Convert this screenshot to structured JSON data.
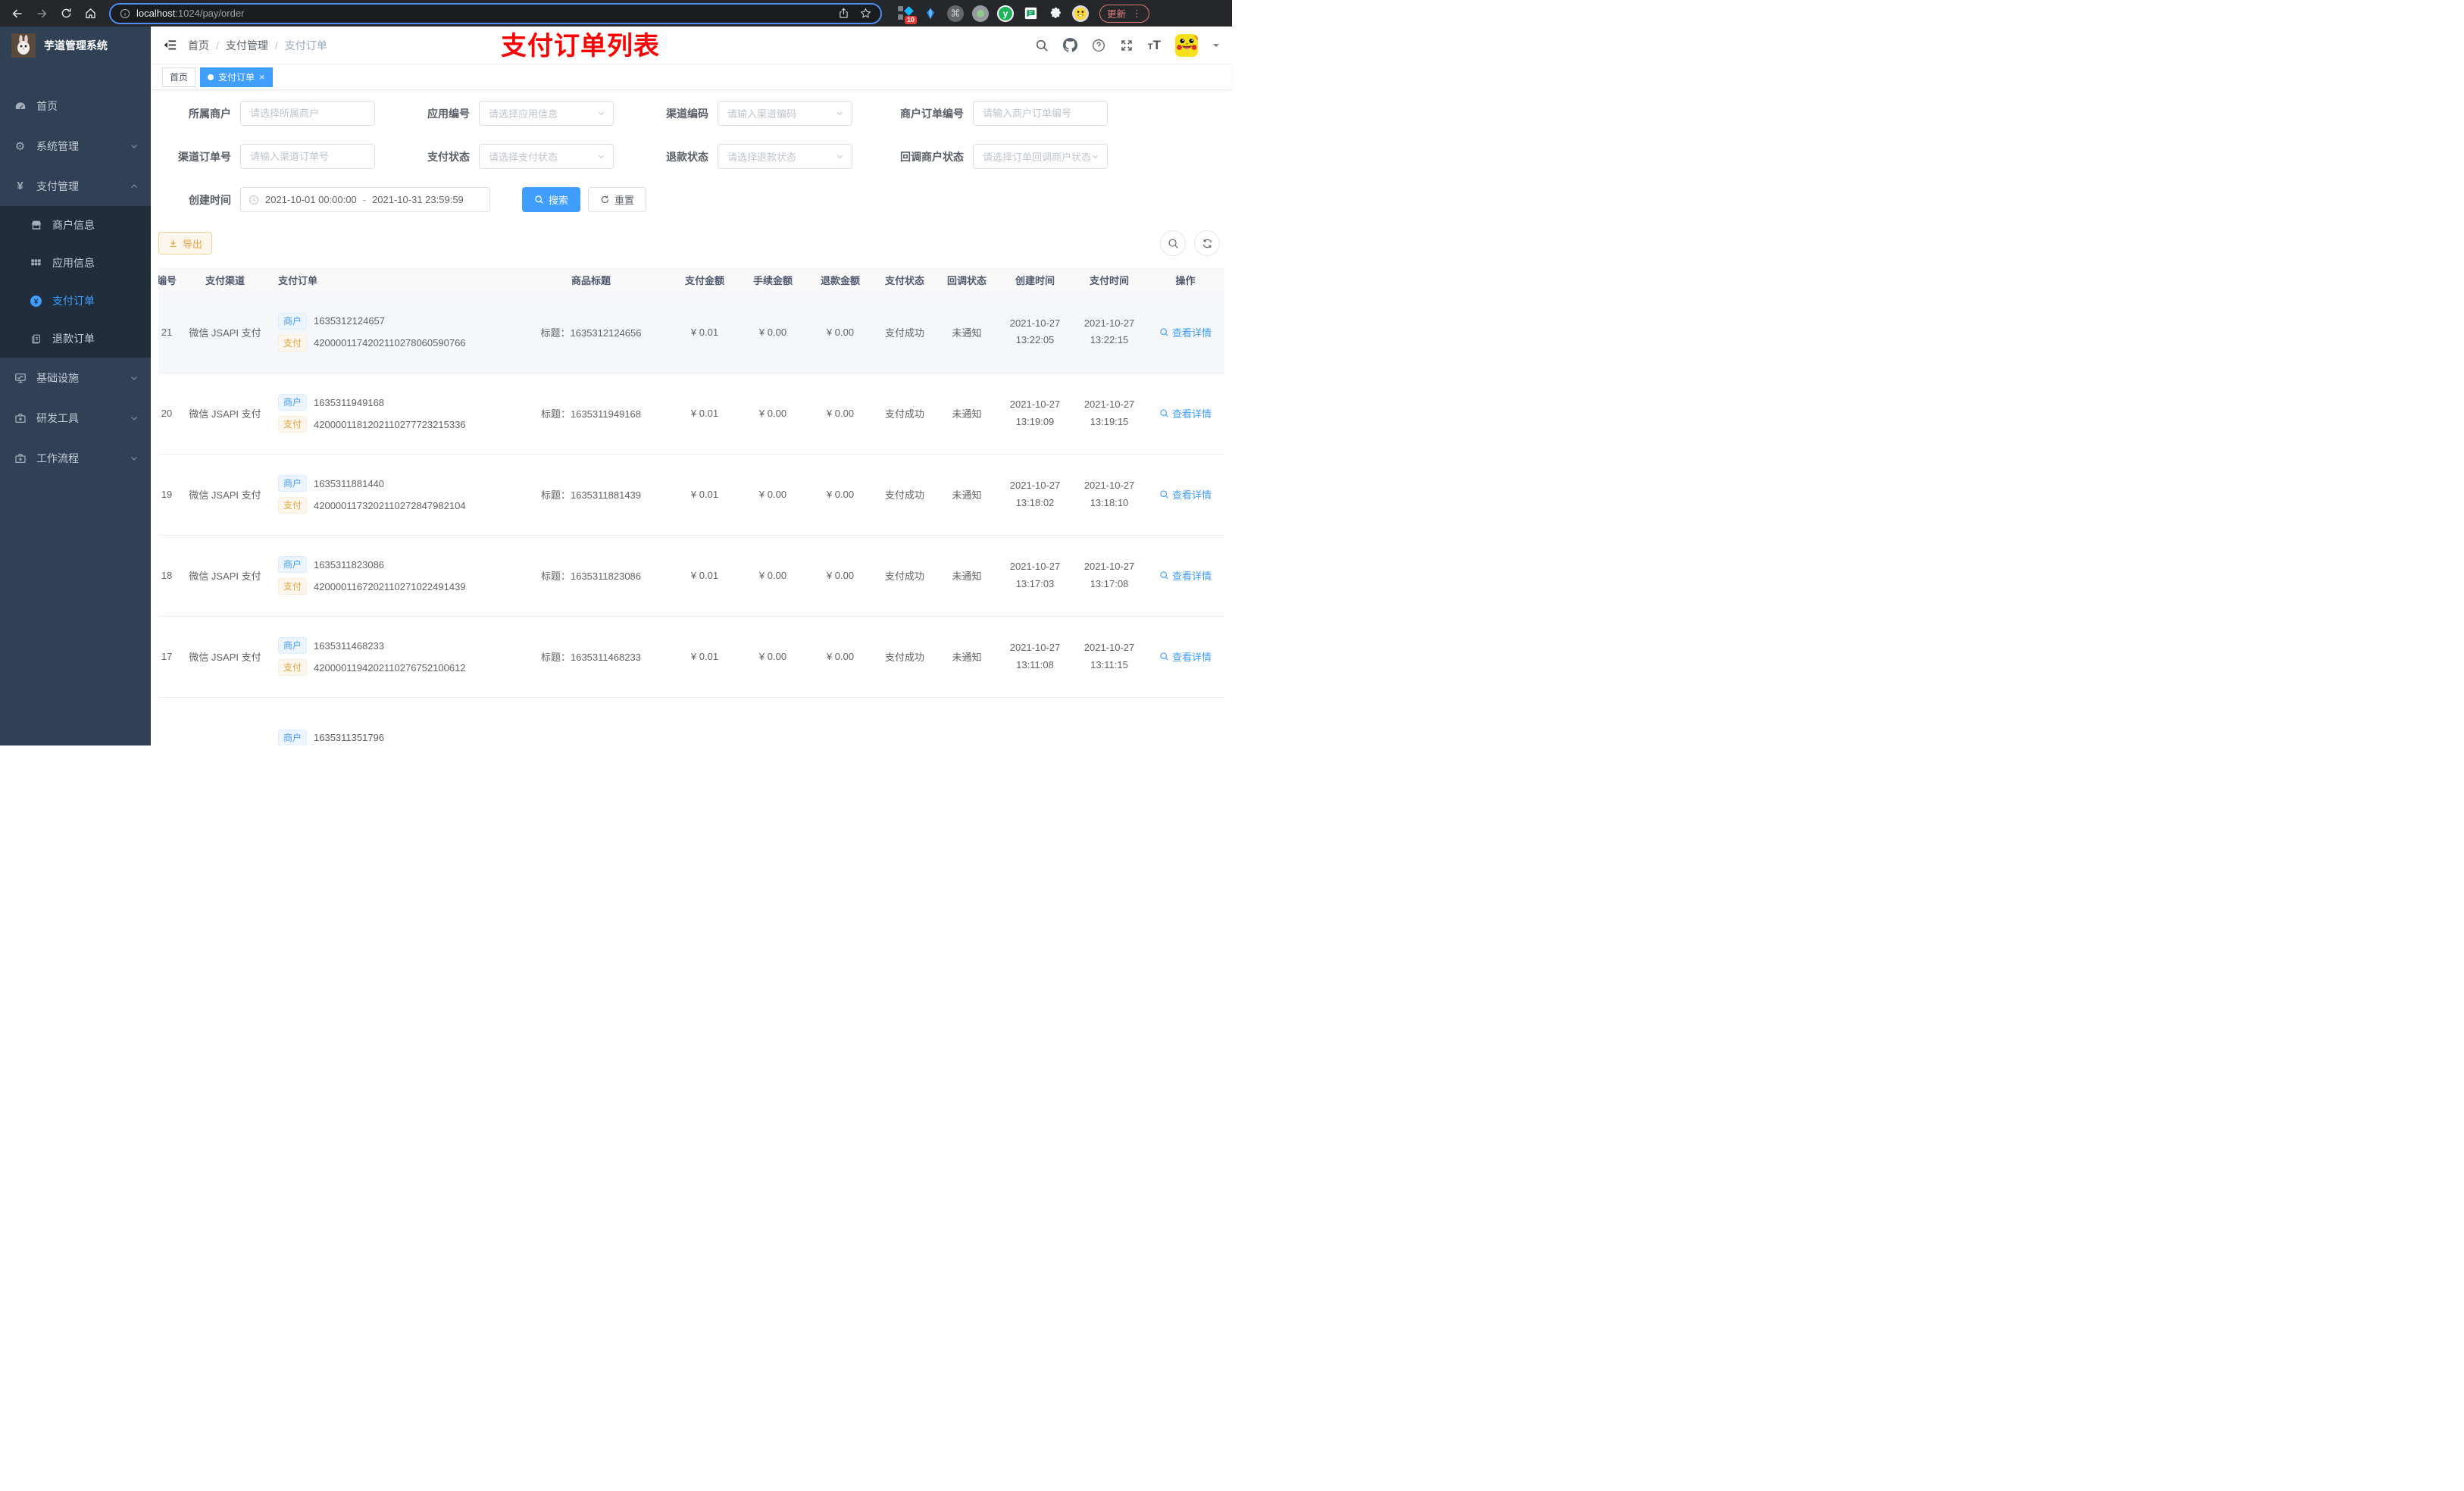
{
  "browser": {
    "url": {
      "host": "localhost",
      "path": ":1024/pay/order"
    },
    "update_label": "更新",
    "extension_badge": "10"
  },
  "colors": {
    "accent": "#409eff",
    "warning": "#e6a23c",
    "annotation": "#fe0000",
    "sidebar_bg": "#304156",
    "submenu_bg": "#1f2d3d"
  },
  "icons": {
    "back-icon": "left arrow",
    "forward-icon": "right arrow",
    "reload-icon": "circular arrow",
    "home-icon": "house",
    "info-icon": "circled i",
    "share-icon": "box with up arrow",
    "star-icon": "star outline",
    "extensions-puzzle-icon": "puzzle piece",
    "more-menu-icon": "vertical dots",
    "fold-icon": "hamburger with left arrow",
    "search-icon": "magnifier",
    "github-icon": "octocat",
    "help-icon": "circled question mark",
    "fullscreen-icon": "expand arrows",
    "font-size-icon": "TT",
    "caret-down-icon": "small down triangle",
    "chevron-down-icon": "v",
    "chevron-up-icon": "^",
    "dashboard-icon": "gauge",
    "gear-icon": "cog",
    "yen-icon": "¥",
    "shop-icon": "storefront",
    "grid-icon": "table grid",
    "pay-circle-icon": "blue circle ¥",
    "document-icon": "copied sheet",
    "monitor-icon": "screen with chart",
    "briefcase-icon": "toolbox",
    "download-icon": "down arrow with bar",
    "refresh-icon": "two circular arrows",
    "clock-icon": "clock",
    "close-icon": "×"
  },
  "sidebar": {
    "title": "芋道管理系统",
    "items": [
      {
        "label": "首页"
      },
      {
        "label": "系统管理",
        "expandable": true
      },
      {
        "label": "支付管理",
        "expandable": true,
        "expanded": true
      },
      {
        "label": "商户信息",
        "sub": true
      },
      {
        "label": "应用信息",
        "sub": true
      },
      {
        "label": "支付订单",
        "sub": true,
        "active": true
      },
      {
        "label": "退款订单",
        "sub": true
      },
      {
        "label": "基础设施",
        "expandable": true
      },
      {
        "label": "研发工具",
        "expandable": true
      },
      {
        "label": "工作流程",
        "expandable": true
      }
    ]
  },
  "navbar": {
    "breadcrumb": [
      "首页",
      "支付管理",
      "支付订单"
    ],
    "annotation": "支付订单列表"
  },
  "tags_view": {
    "tabs": [
      {
        "label": "首页"
      },
      {
        "label": "支付订单",
        "active": true
      }
    ]
  },
  "filters": {
    "merchant": {
      "label": "所属商户",
      "placeholder": "请选择所属商户"
    },
    "app": {
      "label": "应用编号",
      "placeholder": "请选择应用信息"
    },
    "channel_code": {
      "label": "渠道编码",
      "placeholder": "请输入渠道编码"
    },
    "merchant_order_no": {
      "label": "商户订单编号",
      "placeholder": "请输入商户订单编号"
    },
    "channel_order_no": {
      "label": "渠道订单号",
      "placeholder": "请输入渠道订单号"
    },
    "pay_status": {
      "label": "支付状态",
      "placeholder": "请选择支付状态"
    },
    "refund_status": {
      "label": "退款状态",
      "placeholder": "请选择退款状态"
    },
    "callback_status": {
      "label": "回调商户状态",
      "placeholder": "请选择订单回调商户状态"
    },
    "create_time": {
      "label": "创建时间",
      "start": "2021-10-01 00:00:00",
      "separator": "-",
      "end": "2021-10-31 23:59:59"
    },
    "search_label": "搜索",
    "reset_label": "重置"
  },
  "toolbar": {
    "export_label": "导出"
  },
  "table": {
    "columns": [
      "编号",
      "支付渠道",
      "支付订单",
      "商品标题",
      "支付金额",
      "手续金额",
      "退款金额",
      "支付状态",
      "回调状态",
      "创建时间",
      "支付时间",
      "操作"
    ],
    "tag_merchant": "商户",
    "tag_pay": "支付",
    "action_label": "查看详情",
    "rows": [
      {
        "id": "21",
        "channel": "微信 JSAPI 支付",
        "merchant_no": "1635312124657",
        "pay_no": "4200001174202110278060590766",
        "title": "标题：1635312124656",
        "amount": "¥ 0.01",
        "fee": "¥ 0.00",
        "refund": "¥ 0.00",
        "status": "支付成功",
        "notify": "未通知",
        "created_date": "2021-10-27",
        "created_time": "13:22:05",
        "paid_date": "2021-10-27",
        "paid_time": "13:22:15",
        "highlight": true
      },
      {
        "id": "20",
        "channel": "微信 JSAPI 支付",
        "merchant_no": "1635311949168",
        "pay_no": "4200001181202110277723215336",
        "title": "标题：1635311949168",
        "amount": "¥ 0.01",
        "fee": "¥ 0.00",
        "refund": "¥ 0.00",
        "status": "支付成功",
        "notify": "未通知",
        "created_date": "2021-10-27",
        "created_time": "13:19:09",
        "paid_date": "2021-10-27",
        "paid_time": "13:19:15"
      },
      {
        "id": "19",
        "channel": "微信 JSAPI 支付",
        "merchant_no": "1635311881440",
        "pay_no": "4200001173202110272847982104",
        "title": "标题：1635311881439",
        "amount": "¥ 0.01",
        "fee": "¥ 0.00",
        "refund": "¥ 0.00",
        "status": "支付成功",
        "notify": "未通知",
        "created_date": "2021-10-27",
        "created_time": "13:18:02",
        "paid_date": "2021-10-27",
        "paid_time": "13:18:10"
      },
      {
        "id": "18",
        "channel": "微信 JSAPI 支付",
        "merchant_no": "1635311823086",
        "pay_no": "4200001167202110271022491439",
        "title": "标题：1635311823086",
        "amount": "¥ 0.01",
        "fee": "¥ 0.00",
        "refund": "¥ 0.00",
        "status": "支付成功",
        "notify": "未通知",
        "created_date": "2021-10-27",
        "created_time": "13:17:03",
        "paid_date": "2021-10-27",
        "paid_time": "13:17:08"
      },
      {
        "id": "17",
        "channel": "微信 JSAPI 支付",
        "merchant_no": "1635311468233",
        "pay_no": "4200001194202110276752100612",
        "title": "标题：1635311468233",
        "amount": "¥ 0.01",
        "fee": "¥ 0.00",
        "refund": "¥ 0.00",
        "status": "支付成功",
        "notify": "未通知",
        "created_date": "2021-10-27",
        "created_time": "13:11:08",
        "paid_date": "2021-10-27",
        "paid_time": "13:11:15"
      },
      {
        "partial": true,
        "merchant_no": "1635311351796"
      }
    ]
  }
}
